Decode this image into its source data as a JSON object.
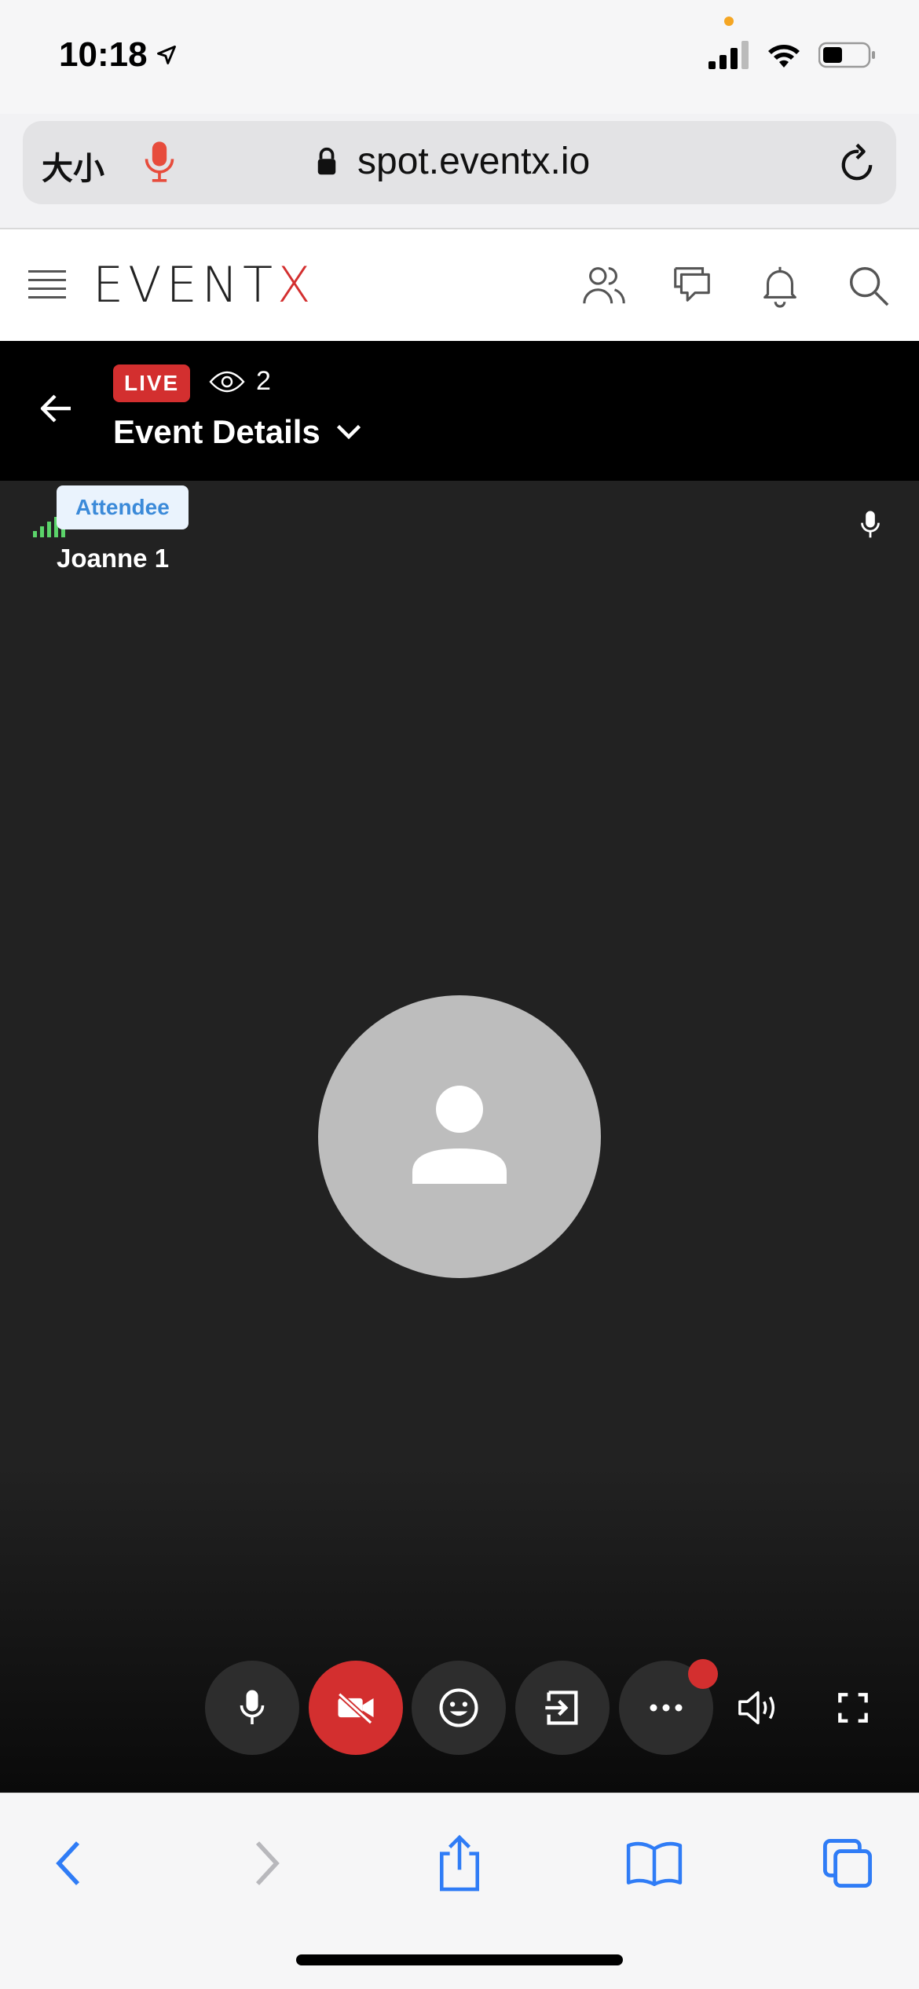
{
  "status_bar": {
    "time": "10:18"
  },
  "browser": {
    "aa_label": "大小",
    "url": "spot.eventx.io"
  },
  "header": {
    "logo_main": "EVENT",
    "logo_accent": "X"
  },
  "event_bar": {
    "live_label": "LIVE",
    "viewer_count": "2",
    "title": "Event Details"
  },
  "video": {
    "role_badge": "Attendee",
    "participant_name": "Joanne 1"
  },
  "colors": {
    "brand_red": "#d32f2f",
    "role_blue": "#3b8ad9",
    "signal_green": "#5bd46a",
    "safari_blue": "#2f7cf6"
  }
}
